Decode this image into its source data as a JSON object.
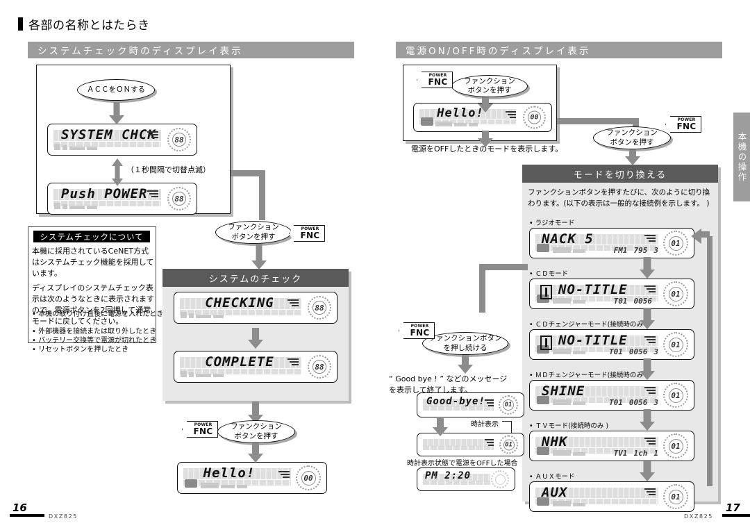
{
  "title": "各部の名称とはたらき",
  "side_tab": "本機の操作",
  "sections": {
    "left_header": "システムチェック時のディスプレイ表示",
    "right_header": "電源ON/OFF時のディスプレイ表示"
  },
  "left_page": {
    "acc_callout": "ＡＣＣをＯＮする",
    "lcd_system_check": {
      "main": "SYSTEM CHCK",
      "dial": "88"
    },
    "blink_note": "（１秒間隔で切替点滅）",
    "lcd_push_power": {
      "main": "Push POWER",
      "dial": "88"
    },
    "fnc_callout_1": {
      "line1": "ファンクション",
      "line2": "ボタンを押す",
      "key_top": "POWER",
      "key_main": "FNC"
    },
    "about_box": {
      "heading": "システムチェックについて",
      "para1": "本機に採用されているCeNET方式はシステムチェック機能を採用しています。",
      "para2": "ディスプレイのシステムチェック表示は次のようなときに表示されますので、電源ボタンを2回押して通常モードに戻してください。",
      "bullets": [
        "本機の取り付け直後に電源を入れたとき",
        "外部機器を接続または取り外したとき",
        "バッテリー交換等で電源が切れたとき",
        "リセットボタンを押したとき"
      ]
    },
    "check_panel": {
      "header": "システムのチェック",
      "lcd_checking": {
        "main": "CHECKING",
        "dial": "88"
      },
      "lcd_complete": {
        "main": "COMPLETE",
        "dial": "88"
      }
    },
    "fnc_callout_2": {
      "line1": "ファンクション",
      "line2": "ボタンを押す",
      "key_top": "POWER",
      "key_main": "FNC"
    },
    "lcd_hello": {
      "main": "Hello!",
      "dial": "00"
    }
  },
  "right_page": {
    "power_box": {
      "fnc_callout": {
        "line1": "ファンクション",
        "line2": "ボタンを押す",
        "key_top": "POWER",
        "key_main": "FNC"
      },
      "lcd_hello": {
        "main": "Hello!",
        "dial": "00"
      },
      "note": "電源をOFFしたときのモードを表示します。"
    },
    "fnc_callout_right": {
      "line1": "ファンクション",
      "line2": "ボタンを押す",
      "key_top": "POWER",
      "key_main": "FNC"
    },
    "fnc_callout_hold": {
      "line1": "ファンクションボタン",
      "line2": "を押し続ける",
      "key_top": "POWER",
      "key_main": "FNC"
    },
    "goodbye_note": "“ Good bye ! ” などのメッセージ\nを表示して終了します。",
    "lcd_goodbye": {
      "main": "Good-bye!",
      "dial": "01"
    },
    "clock_label": "時計表示",
    "lcd_clock_blank": {
      "main": "",
      "dial": "01"
    },
    "clock_off_note": "時計表示状態で電源をOFFした場合",
    "lcd_clock": {
      "main": "PM  2:20",
      "dial": ""
    },
    "mode_panel": {
      "header": "モードを切り換える",
      "intro": "ファンクションボタンを押すたびに、次のように切り換わります。(以下の表示は一般的な接続例を示します。 )",
      "modes": [
        {
          "label": "ラジオモード",
          "main": "NACK 5",
          "sub1": "FM1",
          "sub2": "795",
          "sub3": "3",
          "dial": "01",
          "disc": false
        },
        {
          "label": "ＣＤモード",
          "main": "NO-TITLE",
          "sub1": "T01",
          "sub2": "0056",
          "sub3": "",
          "dial": "01",
          "disc": true
        },
        {
          "label": "ＣＤチェンジャーモード(接続時のみ )",
          "main": "NO-TITLE",
          "sub1": "T01",
          "sub2": "0056",
          "sub3": "3",
          "dial": "01",
          "disc": true
        },
        {
          "label": "ＭＤチェンジャーモード(接続時のみ )",
          "main": "SHINE",
          "sub1": "T01",
          "sub2": "0056",
          "sub3": "3",
          "dial": "01",
          "disc": false
        },
        {
          "label": "ＴＶモード(接続時のみ )",
          "main": "NHK",
          "sub1": "TV1",
          "sub2": "1ch",
          "sub3": "1",
          "dial": "01",
          "disc": false
        },
        {
          "label": "ＡＵＸモード",
          "main": "AUX",
          "sub1": "",
          "sub2": "",
          "sub3": "",
          "dial": "01",
          "disc": false
        }
      ]
    }
  },
  "footer": {
    "left_page_number": "16",
    "left_model": "DXZ825",
    "right_page_number": "17",
    "right_model": "DXZ825"
  }
}
